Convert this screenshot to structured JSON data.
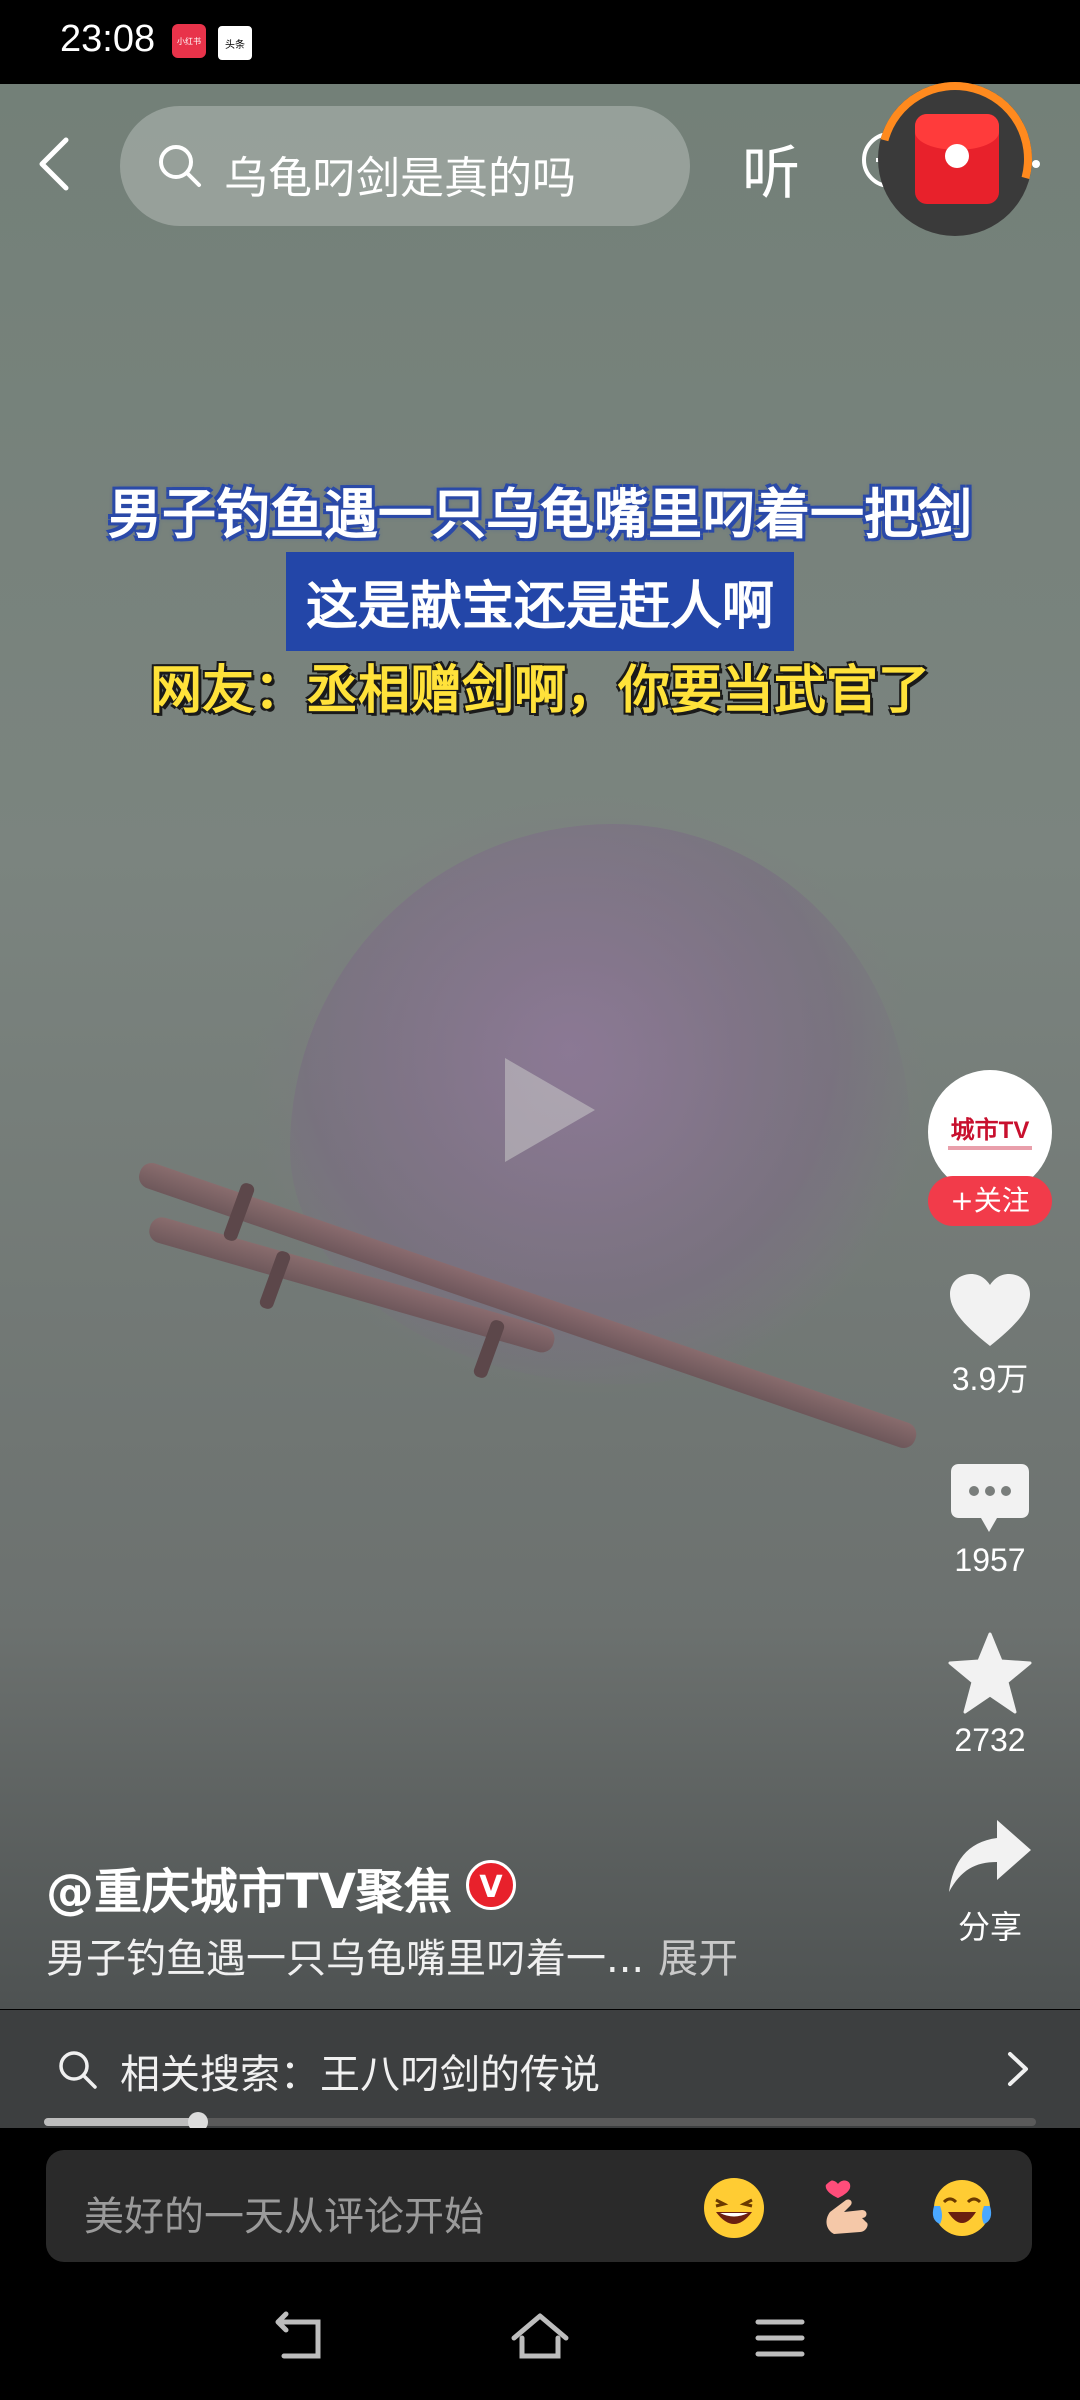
{
  "status_bar": {
    "time": "23:08",
    "app1": "小红书",
    "app2": "头条"
  },
  "search": {
    "query": "乌龟叼剑是真的吗",
    "listen_label": "听"
  },
  "captions": {
    "line1": "男子钓鱼遇一只乌龟嘴里叼着一把剑",
    "line2": "这是献宝还是赶人啊",
    "line3": "网友：丞相赠剑啊，你要当武官了"
  },
  "avatar": {
    "text": "城市TV",
    "follow_label": "+关注"
  },
  "actions": {
    "likes": "3.9万",
    "comments": "1957",
    "favorites": "2732",
    "share_label": "分享"
  },
  "post": {
    "author": "@重庆城市TV聚焦",
    "verified_mark": "V",
    "description": "男子钓鱼遇一只乌龟嘴里叼着一...",
    "expand_label": "展开"
  },
  "related": {
    "text": "相关搜索：王八叼剑的传说"
  },
  "progress": {
    "fraction": 0.155
  },
  "comment": {
    "placeholder": "美好的一天从评论开始"
  },
  "colors": {
    "accent_red": "#f23b4a",
    "caption_blue": "#2346a8",
    "caption_yellow": "#ffe23a"
  }
}
